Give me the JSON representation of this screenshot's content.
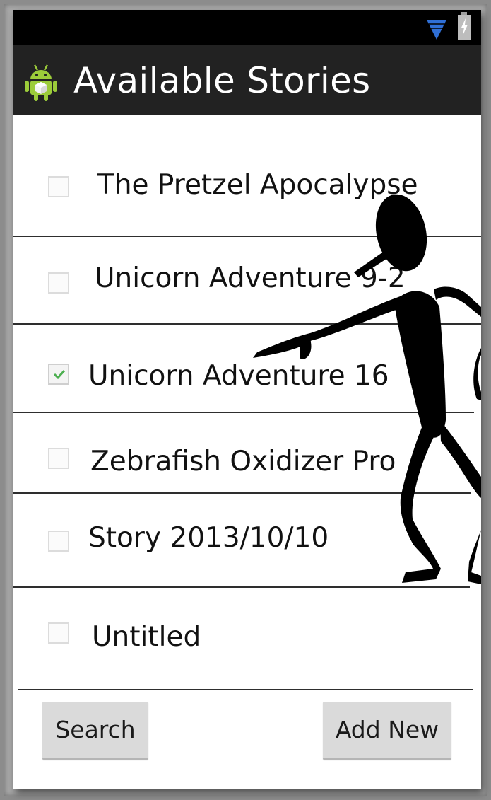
{
  "window": {
    "title": "Available Stories"
  },
  "status_bar": {
    "icons": [
      "wifi-icon",
      "battery-charging-icon"
    ]
  },
  "action_bar": {
    "icon": "android-icon",
    "title": "Available Stories"
  },
  "stories": [
    {
      "label": "The Pretzel Apocalypse",
      "checked": false
    },
    {
      "label": "Unicorn Adventure 9-2",
      "checked": false
    },
    {
      "label": "Unicorn Adventure 16",
      "checked": true
    },
    {
      "label": "Zebrafish Oxidizer Pro",
      "checked": false
    },
    {
      "label": "Story 2013/10/10",
      "checked": false
    },
    {
      "label": "Untitled",
      "checked": false
    }
  ],
  "buttons": {
    "search_label": "Search",
    "add_new_label": "Add New"
  },
  "colors": {
    "status_bar": "#000000",
    "action_bar": "#222222",
    "checkmark": "#4caf50",
    "wifi": "#2f6fd6"
  }
}
